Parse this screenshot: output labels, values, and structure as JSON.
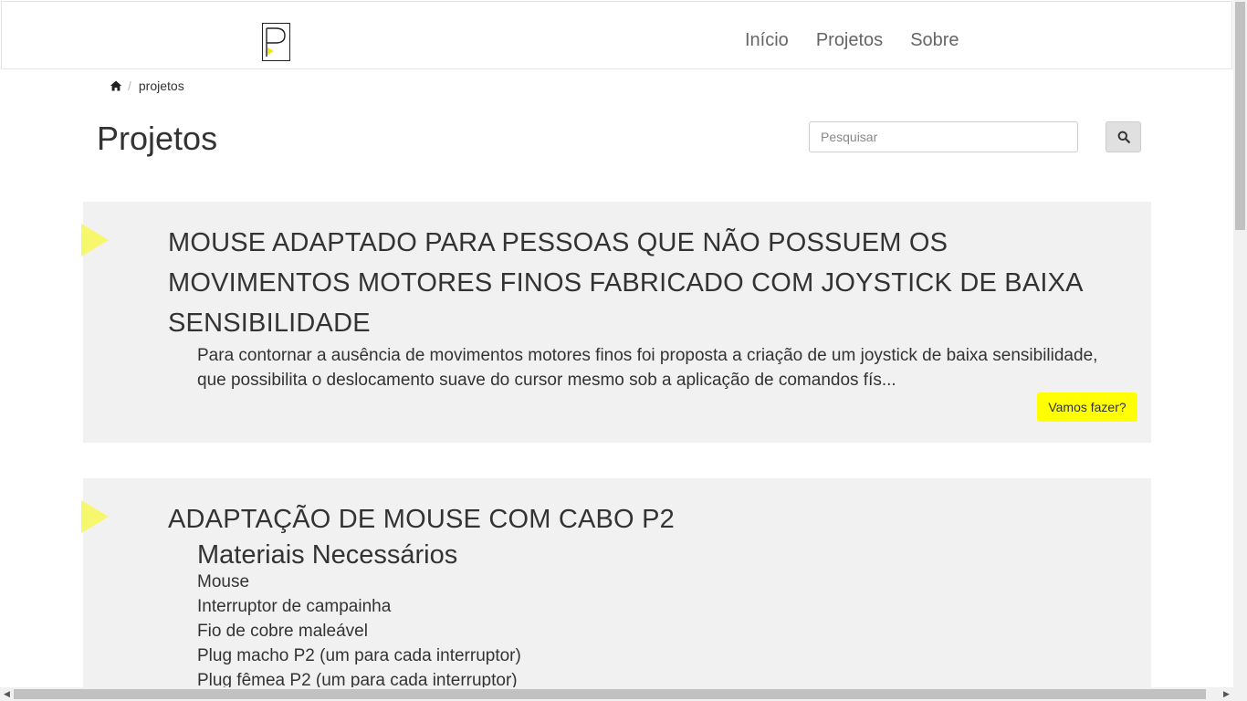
{
  "nav": {
    "links": [
      "Início",
      "Projetos",
      "Sobre"
    ]
  },
  "breadcrumb": {
    "home_icon": "home-icon",
    "current": "projetos"
  },
  "page": {
    "title": "Projetos"
  },
  "search": {
    "placeholder": "Pesquisar",
    "value": "",
    "icon": "search-icon"
  },
  "projects": [
    {
      "title": "MOUSE ADAPTADO PARA PESSOAS QUE NÃO POSSUEM OS MOVIMENTOS MOTORES FINOS FABRICADO COM JOYSTICK DE BAIXA SENSIBILIDADE",
      "description": "Para contornar a ausência de movimentos motores finos foi proposta a criação de um joystick de baixa sensibilidade, que possibilita o deslocamento suave do cursor mesmo sob a aplicação de comandos fís...",
      "button": "Vamos fazer?"
    },
    {
      "title": "ADAPTAÇÃO DE MOUSE COM CABO P2",
      "subtitle": "Materiais Necessários",
      "materials": [
        "Mouse",
        "Interruptor de campainha",
        "Fio de cobre maleável",
        "Plug macho P2 (um para cada interruptor)",
        "Plug fêmea P2 (um para cada interruptor)"
      ]
    }
  ],
  "colors": {
    "accent": "#ffff00",
    "triangle": "#f7f76e",
    "card_bg": "#f1f1f1"
  }
}
